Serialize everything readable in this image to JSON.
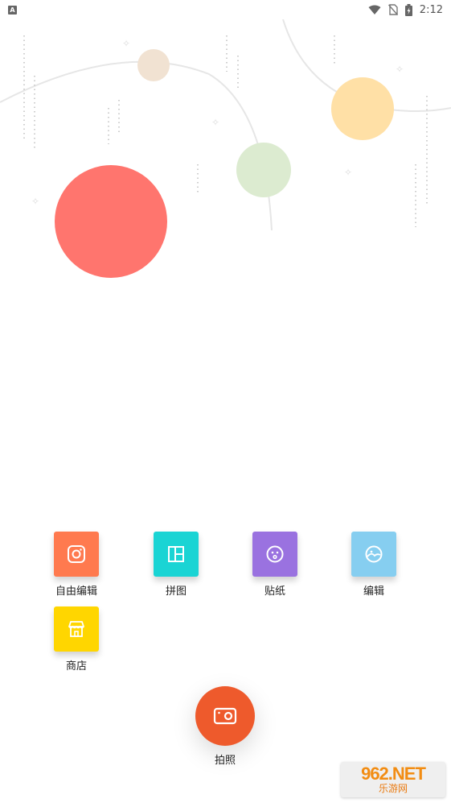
{
  "status_bar": {
    "notification_icon_letter": "A",
    "time": "2:12",
    "icons": [
      "wifi-icon",
      "no-sim-icon",
      "battery-charging-icon"
    ]
  },
  "colors": {
    "red_bubble": "#ff756e",
    "orange_bubble": "#ffe0a6",
    "green_bubble": "#dcebd0",
    "tan_bubble": "#f1e2d2",
    "shoot_button": "#ee5a2c"
  },
  "features": [
    {
      "label": "自由编辑",
      "icon": "instagram-camera-icon",
      "color": "#ff7a4f"
    },
    {
      "label": "拼图",
      "icon": "collage-layout-icon",
      "color": "#1ad4d4"
    },
    {
      "label": "贴纸",
      "icon": "smiley-sticker-icon",
      "color": "#9a72e0"
    },
    {
      "label": "编辑",
      "icon": "photo-edit-icon",
      "color": "#86cef0"
    },
    {
      "label": "商店",
      "icon": "store-icon",
      "color": "#ffd600"
    }
  ],
  "shoot": {
    "label": "拍照",
    "icon": "camera-icon"
  },
  "watermark": {
    "top": "962.NET",
    "bottom": "乐游网"
  }
}
